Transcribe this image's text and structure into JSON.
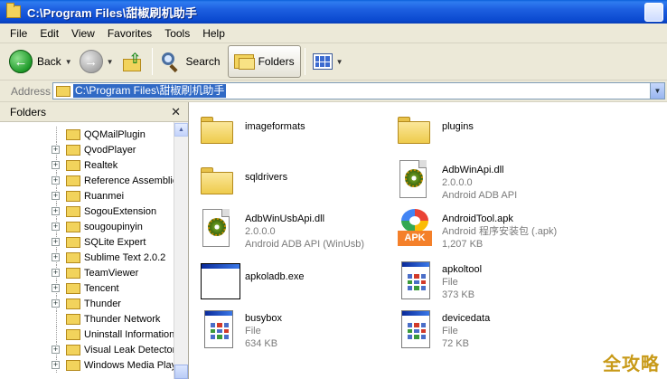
{
  "window": {
    "title": "C:\\Program Files\\甜椒刷机助手",
    "accent_color": "#0a4ad0"
  },
  "menu": [
    "File",
    "Edit",
    "View",
    "Favorites",
    "Tools",
    "Help"
  ],
  "toolbar": {
    "back_label": "Back",
    "search_label": "Search",
    "folders_label": "Folders"
  },
  "address": {
    "label": "Address",
    "value": "C:\\Program Files\\甜椒刷机助手"
  },
  "folders_pane": {
    "title": "Folders",
    "items": [
      {
        "label": "QQMailPlugin",
        "expander": false
      },
      {
        "label": "QvodPlayer",
        "expander": true
      },
      {
        "label": "Realtek",
        "expander": true
      },
      {
        "label": "Reference Assemblie",
        "expander": true
      },
      {
        "label": "Ruanmei",
        "expander": true
      },
      {
        "label": "SogouExtension",
        "expander": true
      },
      {
        "label": "sougoupinyin",
        "expander": true
      },
      {
        "label": "SQLite Expert",
        "expander": true
      },
      {
        "label": "Sublime Text 2.0.2",
        "expander": true
      },
      {
        "label": "TeamViewer",
        "expander": true
      },
      {
        "label": "Tencent",
        "expander": true
      },
      {
        "label": "Thunder",
        "expander": true
      },
      {
        "label": "Thunder Network",
        "expander": false
      },
      {
        "label": "Uninstall Information",
        "expander": false
      },
      {
        "label": "Visual Leak Detector",
        "expander": true
      },
      {
        "label": "Windows Media Play",
        "expander": true
      }
    ]
  },
  "files": [
    {
      "name": "imageformats",
      "line2": "",
      "line3": "",
      "icon": "folder-icon"
    },
    {
      "name": "plugins",
      "line2": "",
      "line3": "",
      "icon": "folder-icon"
    },
    {
      "name": "sqldrivers",
      "line2": "",
      "line3": "",
      "icon": "folder-icon"
    },
    {
      "name": "AdbWinApi.dll",
      "line2": "2.0.0.0",
      "line3": "Android ADB API",
      "icon": "dll-icon"
    },
    {
      "name": "AdbWinUsbApi.dll",
      "line2": "2.0.0.0",
      "line3": "Android ADB API (WinUsb)",
      "icon": "dll-icon"
    },
    {
      "name": "AndroidTool.apk",
      "line2": "Android 程序安装包 (.apk)",
      "line3": "1,207 KB",
      "icon": "apk-icon"
    },
    {
      "name": "apkoladb.exe",
      "line2": "",
      "line3": "",
      "icon": "exe-icon"
    },
    {
      "name": "apkoltool",
      "line2": "File",
      "line3": "373 KB",
      "icon": "file-icon"
    },
    {
      "name": "busybox",
      "line2": "File",
      "line3": "634 KB",
      "icon": "file-icon"
    },
    {
      "name": "devicedata",
      "line2": "File",
      "line3": "72 KB",
      "icon": "file-icon"
    }
  ],
  "watermark": "全攻略"
}
